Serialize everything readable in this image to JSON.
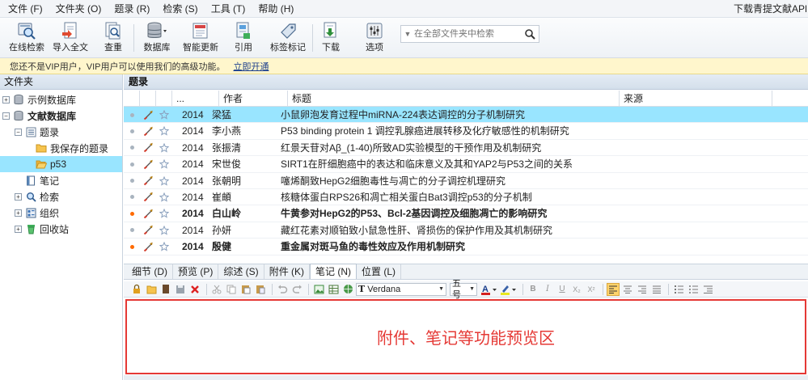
{
  "menu": {
    "items": [
      "文件 (F)",
      "文件夹 (O)",
      "题录 (R)",
      "检索 (S)",
      "工具 (T)",
      "帮助 (H)"
    ],
    "right_link": "下载青提文献APP"
  },
  "toolbar": {
    "buttons": [
      {
        "label": "在线检索",
        "icon": "online-search-icon"
      },
      {
        "label": "导入全文",
        "icon": "import-fulltext-icon"
      },
      {
        "label": "查重",
        "icon": "duplicate-check-icon"
      },
      {
        "label": "数据库",
        "icon": "database-icon"
      },
      {
        "label": "智能更新",
        "icon": "smart-update-icon"
      },
      {
        "label": "引用",
        "icon": "cite-icon"
      },
      {
        "label": "标签标记",
        "icon": "tag-icon"
      },
      {
        "label": "下载",
        "icon": "download-icon"
      },
      {
        "label": "选项",
        "icon": "options-icon"
      }
    ],
    "search_placeholder": "在全部文件夹中检索"
  },
  "vip": {
    "message": "您还不是VIP用户，VIP用户可以使用我们的高级功能。",
    "link": "立即开通"
  },
  "folders": {
    "header": "文件夹",
    "items": [
      {
        "label": "示例数据库",
        "icon": "database-icon",
        "expander": "+"
      },
      {
        "label": "文献数据库",
        "icon": "database-icon",
        "expander": "−"
      },
      {
        "label": "题录",
        "icon": "list-icon",
        "expander": "−"
      },
      {
        "label": "我保存的题录",
        "icon": "folder-icon",
        "expander": ""
      },
      {
        "label": "p53",
        "icon": "folder-open-icon",
        "expander": ""
      },
      {
        "label": "笔记",
        "icon": "note-icon",
        "expander": ""
      },
      {
        "label": "检索",
        "icon": "search-icon",
        "expander": "+"
      },
      {
        "label": "组织",
        "icon": "organize-icon",
        "expander": "+"
      },
      {
        "label": "回收站",
        "icon": "recycle-bin-icon",
        "expander": "+"
      }
    ]
  },
  "main": {
    "header": "题录",
    "columns": {
      "blank": "...",
      "author": "作者",
      "title": "标题",
      "source": "来源"
    },
    "rows": [
      {
        "year": "2014",
        "author": "梁猛",
        "title": "小鼠卵泡发育过程中miRNA-224表达调控的分子机制研究",
        "source": "",
        "unread": false
      },
      {
        "year": "2014",
        "author": "李小燕",
        "title": "P53 binding protein 1 调控乳腺癌进展转移及化疗敏感性的机制研究",
        "source": "",
        "unread": false
      },
      {
        "year": "2014",
        "author": "张振清",
        "title": "红景天苷对Aβ_(1-40)所致AD实验模型的干预作用及机制研究",
        "source": "",
        "unread": false
      },
      {
        "year": "2014",
        "author": "宋世俊",
        "title": "SIRT1在肝细胞癌中的表达和临床意义及其和YAP2与P53之间的关系",
        "source": "",
        "unread": false
      },
      {
        "year": "2014",
        "author": "张朝明",
        "title": "噻烯酮致HepG2细胞毒性与凋亡的分子调控机理研究",
        "source": "",
        "unread": false
      },
      {
        "year": "2014",
        "author": "崔頔",
        "title": "核糖体蛋白RPS26和凋亡相关蛋白Bat3调控p53的分子机制",
        "source": "",
        "unread": false
      },
      {
        "year": "2014",
        "author": "白山岭",
        "title": "牛黄参对HepG2的P53、Bcl-2基因调控及细胞凋亡的影响研究",
        "source": "",
        "unread": true
      },
      {
        "year": "2014",
        "author": "孙妍",
        "title": "藏红花素对顺铂致小鼠急性肝、肾损伤的保护作用及其机制研究",
        "source": "",
        "unread": false
      },
      {
        "year": "2014",
        "author": "殷健",
        "title": "重金属对斑马鱼的毒性效应及作用机制研究",
        "source": "",
        "unread": true
      }
    ]
  },
  "tabs": [
    "细节 (D)",
    "预览 (P)",
    "综述 (S)",
    "附件 (K)",
    "笔记 (N)",
    "位置 (L)"
  ],
  "active_tab": 4,
  "editor": {
    "font": "Verdana",
    "size": "五号"
  },
  "preview_text": "附件、笔记等功能预览区",
  "colors": {
    "selected": "#99e5ff",
    "unread_dot": "#ff6a00",
    "read_dot": "#a9b4bf",
    "preview_border": "#e53935"
  }
}
